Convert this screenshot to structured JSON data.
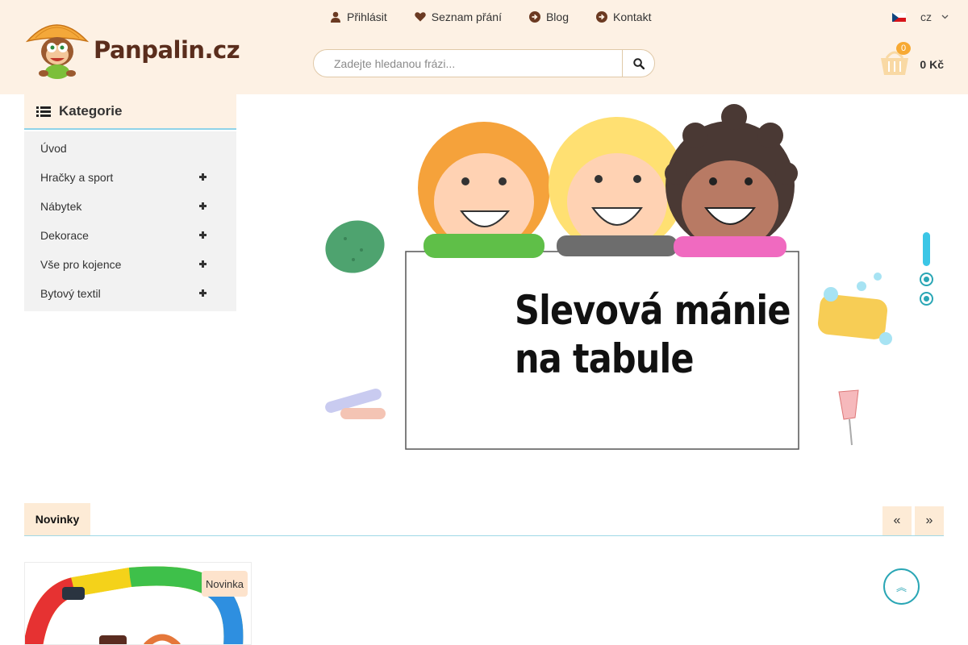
{
  "header": {
    "logo_text": "Panpalin.cz",
    "nav": [
      {
        "label": "Přihlásit",
        "icon": "user-icon"
      },
      {
        "label": "Seznam přání",
        "icon": "heart-icon"
      },
      {
        "label": "Blog",
        "icon": "arrow-circle-icon"
      },
      {
        "label": "Kontakt",
        "icon": "arrow-circle-icon"
      }
    ],
    "search_placeholder": "Zadejte hledanou frázi...",
    "language": "cz",
    "cart_count": "0",
    "cart_total": "0 Kč"
  },
  "sidebar": {
    "title": "Kategorie",
    "items": [
      {
        "label": "Úvod",
        "expandable": false
      },
      {
        "label": "Hračky a sport",
        "expandable": true
      },
      {
        "label": "Nábytek",
        "expandable": true
      },
      {
        "label": "Dekorace",
        "expandable": true
      },
      {
        "label": "Vše pro kojence",
        "expandable": true
      },
      {
        "label": "Bytový textil",
        "expandable": true
      }
    ]
  },
  "banner": {
    "line1": "Slevová mánie",
    "line2": "na tabule",
    "slides_total": 3,
    "active_slide": 1
  },
  "novinky": {
    "tab_label": "Novinky",
    "badge": "Novinka"
  },
  "colors": {
    "header_bg": "#fdf1e4",
    "accent_blue": "#3bc6e6",
    "accent_teal": "#2aa6b5",
    "badge_orange": "#f7a933",
    "brand_brown": "#5a2d1c"
  }
}
